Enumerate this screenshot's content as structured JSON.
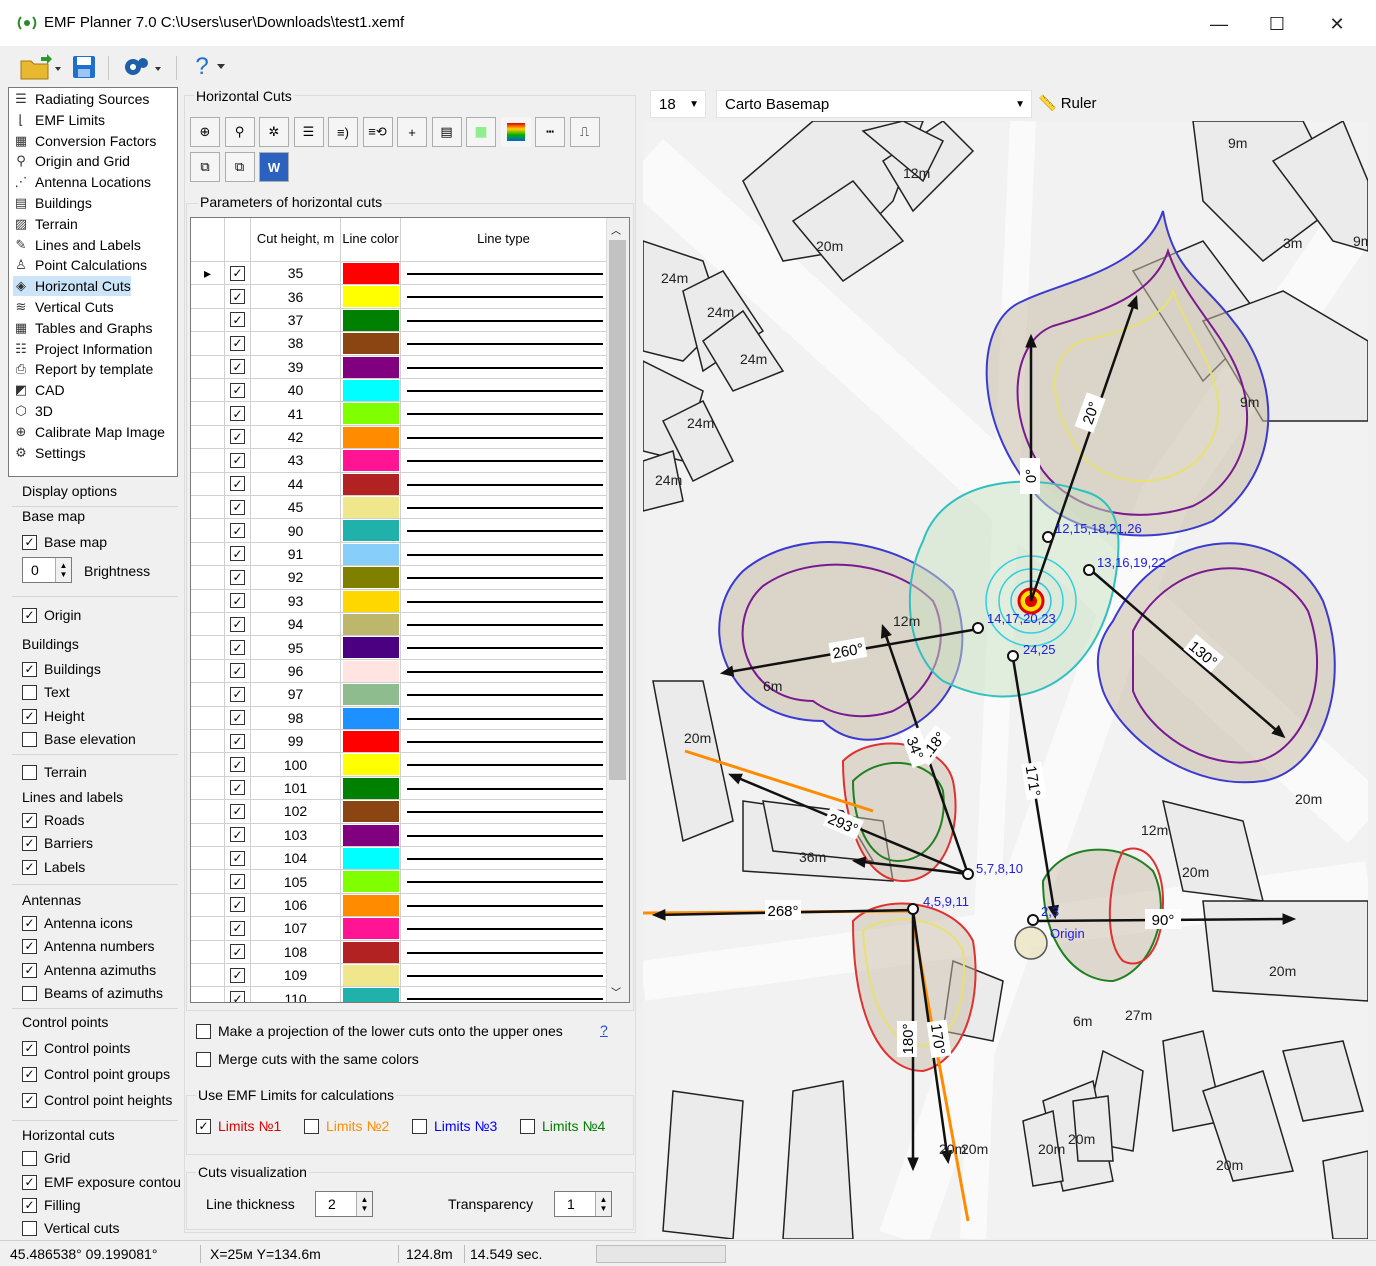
{
  "window": {
    "title": "EMF Planner 7.0 C:\\Users\\user\\Downloads\\test1.xemf",
    "minimize": "—",
    "maximize": "☐",
    "close": "✕"
  },
  "toolbar": {
    "help_label": "?"
  },
  "nav": {
    "items": [
      {
        "label": "Radiating Sources",
        "icon": "list-icon"
      },
      {
        "label": "EMF Limits",
        "icon": "limits-icon"
      },
      {
        "label": "Conversion Factors",
        "icon": "table-icon"
      },
      {
        "label": "Origin and Grid",
        "icon": "pin-icon"
      },
      {
        "label": "Antenna Locations",
        "icon": "antenna-icon"
      },
      {
        "label": "Buildings",
        "icon": "building-icon"
      },
      {
        "label": "Terrain",
        "icon": "terrain-icon"
      },
      {
        "label": "Lines and Labels",
        "icon": "pen-icon"
      },
      {
        "label": "Point Calculations",
        "icon": "person-pin-icon"
      },
      {
        "label": "Horizontal Cuts",
        "icon": "layers-icon"
      },
      {
        "label": "Vertical Cuts",
        "icon": "vertical-cuts-icon"
      },
      {
        "label": "Tables and Graphs",
        "icon": "grid-icon"
      },
      {
        "label": "Project Information",
        "icon": "info-list-icon"
      },
      {
        "label": "Report by template",
        "icon": "printer-icon"
      },
      {
        "label": "CAD",
        "icon": "cad-icon"
      },
      {
        "label": "3D",
        "icon": "cube-icon"
      },
      {
        "label": "Calibrate Map Image",
        "icon": "target-icon"
      },
      {
        "label": "Settings",
        "icon": "gear-icon"
      }
    ],
    "selected": "Horizontal Cuts"
  },
  "display": {
    "title": "Display options",
    "base_map_head": "Base map",
    "base_map": "Base map",
    "brightness_value": "0",
    "brightness": "Brightness",
    "origin": "Origin",
    "buildings_head": "Buildings",
    "buildings": "Buildings",
    "text": "Text",
    "height": "Height",
    "base_elevation": "Base elevation",
    "terrain": "Terrain",
    "lines_head": "Lines and labels",
    "roads": "Roads",
    "barriers": "Barriers",
    "labels": "Labels",
    "antennas_head": "Antennas",
    "antenna_icons": "Antenna icons",
    "antenna_numbers": "Antenna numbers",
    "antenna_azimuths": "Antenna azimuths",
    "beams": "Beams of azimuths",
    "cp_head": "Control points",
    "control_points": "Control points",
    "cp_groups": "Control point groups",
    "cp_heights": "Control point heights",
    "hc_head": "Horizontal cuts",
    "grid": "Grid",
    "emf_contour": "EMF exposure contou",
    "filling": "Filling",
    "vertical_cuts": "Vertical cuts"
  },
  "panel": {
    "title": "Horizontal Cuts",
    "params_label": "Parameters of horizontal cuts",
    "col_height": "Cut height, m",
    "col_color": "Line color",
    "col_type": "Line type",
    "rows": [
      {
        "h": "35",
        "c": "#ff0000"
      },
      {
        "h": "36",
        "c": "#ffff00"
      },
      {
        "h": "37",
        "c": "#008000"
      },
      {
        "h": "38",
        "c": "#8b4513"
      },
      {
        "h": "39",
        "c": "#800080"
      },
      {
        "h": "40",
        "c": "#00ffff"
      },
      {
        "h": "41",
        "c": "#7fff00"
      },
      {
        "h": "42",
        "c": "#ff8c00"
      },
      {
        "h": "43",
        "c": "#ff1493"
      },
      {
        "h": "44",
        "c": "#b22222"
      },
      {
        "h": "45",
        "c": "#f0e68c"
      },
      {
        "h": "90",
        "c": "#20b2aa"
      },
      {
        "h": "91",
        "c": "#87cefa"
      },
      {
        "h": "92",
        "c": "#808000"
      },
      {
        "h": "93",
        "c": "#ffd700"
      },
      {
        "h": "94",
        "c": "#bdb76b"
      },
      {
        "h": "95",
        "c": "#4b0082"
      },
      {
        "h": "96",
        "c": "#ffe4e1"
      },
      {
        "h": "97",
        "c": "#8fbc8f"
      },
      {
        "h": "98",
        "c": "#1e90ff"
      },
      {
        "h": "99",
        "c": "#ff0000"
      },
      {
        "h": "100",
        "c": "#ffff00"
      },
      {
        "h": "101",
        "c": "#008000"
      },
      {
        "h": "102",
        "c": "#8b4513"
      },
      {
        "h": "103",
        "c": "#800080"
      },
      {
        "h": "104",
        "c": "#00ffff"
      },
      {
        "h": "105",
        "c": "#7fff00"
      },
      {
        "h": "106",
        "c": "#ff8c00"
      },
      {
        "h": "107",
        "c": "#ff1493"
      },
      {
        "h": "108",
        "c": "#b22222"
      },
      {
        "h": "109",
        "c": "#f0e68c"
      },
      {
        "h": "110",
        "c": "#20b2aa"
      }
    ],
    "projection": "Make a projection of the lower cuts onto the upper ones",
    "help": "?",
    "merge": "Merge cuts with the same colors",
    "limits_group": "Use EMF Limits for calculations",
    "limit1": "Limits №1",
    "limit2": "Limits №2",
    "limit3": "Limits №3",
    "limit4": "Limits №4",
    "limit_colors": [
      "#e00000",
      "#ff8c00",
      "#0000ff",
      "#008000"
    ],
    "viz_group": "Cuts visualization",
    "line_thickness": "Line thickness",
    "line_thickness_value": "2",
    "transparency": "Transparency",
    "transparency_value": "1"
  },
  "map": {
    "zoom": "18",
    "basemap": "Carto Basemap",
    "ruler": "Ruler",
    "heights": [
      "9m",
      "12m",
      "20m",
      "3m",
      "9m",
      "24m",
      "24m",
      "24m",
      "24m",
      "24m",
      "9m",
      "20m",
      "20m",
      "12m",
      "12m",
      "36m",
      "20m",
      "20m",
      "20m",
      "20m",
      "20m",
      "27m",
      "20m",
      "20m",
      "6m",
      "6m"
    ],
    "azimuths": [
      "20°",
      "0°",
      "130°",
      "260°",
      "218°",
      "34°",
      "171°",
      "293°",
      "268°",
      "90°",
      "180°",
      "170°"
    ],
    "antennas": [
      "12,15,18,21,26",
      "13,16,19,22",
      "14,17,20,23",
      "24,25",
      "5,7,8,10",
      "4,5,9,11",
      "2,3",
      "Origin"
    ]
  },
  "status": {
    "coords": "45.486538° 09.199081°",
    "xy": "X=25м  Y=134.6m",
    "dist": "124.8m",
    "time": "14.549 sec."
  }
}
